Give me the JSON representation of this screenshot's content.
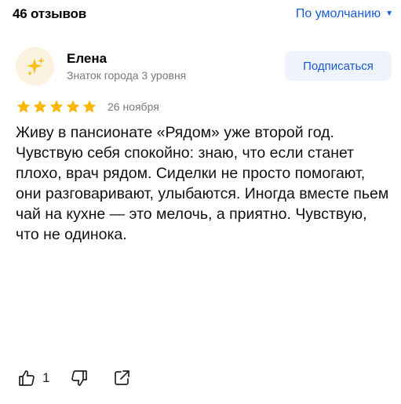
{
  "reviews_header": {
    "count_label": "46 отзывов",
    "sort_label": "По умолчанию"
  },
  "review": {
    "author": {
      "name": "Елена",
      "status": "Знаток города 3 уровня",
      "avatar_icon": "sparkles-icon"
    },
    "subscribe_label": "Подписаться",
    "rating": 5,
    "rating_max": 5,
    "date": "26 ноября",
    "text": "Живу в пансионате «Рядом» уже второй год. Чувствую себя спокойно: знаю, что если станет плохо, врач рядом. Сиделки не просто помогают, они разговаривают, улыбаются. Иногда вместе пьем чай на кухне — это мелочь, а приятно. Чувствую, что не одинока.",
    "likes": "1",
    "icons": {
      "like": "thumbs-up-icon",
      "dislike": "thumbs-down-icon",
      "share": "share-icon",
      "sort": "caret-down-icon"
    }
  },
  "colors": {
    "accent": "#1a5bd6",
    "star": "#fcb700",
    "button_bg": "#eef3fc",
    "muted_text": "#7a7a7a",
    "avatar_bg": "#fbf3df"
  }
}
